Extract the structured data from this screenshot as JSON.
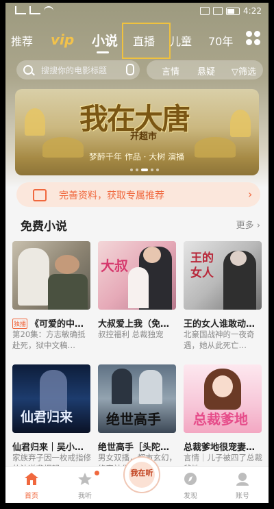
{
  "status": {
    "time": "4:22"
  },
  "tabs": [
    {
      "label": "推荐"
    },
    {
      "label": "vip"
    },
    {
      "label": "小说"
    },
    {
      "label": "直播"
    },
    {
      "label": "儿童"
    },
    {
      "label": "70年"
    }
  ],
  "search": {
    "placeholder": "搜搜你的电影标题",
    "filters": [
      "言情",
      "悬疑",
      "筛选"
    ]
  },
  "banner": {
    "title": "我在大唐",
    "subtitle": "开超市",
    "credit": "梦醉千年 作品 · 大树 演播"
  },
  "profile_tip": {
    "text": "完善资料，获取专属推荐"
  },
  "free_section": {
    "title": "免费小说",
    "more": "更多"
  },
  "books": [
    {
      "badge": "独播",
      "title": "《可爱的中…",
      "desc": "第20集：方志敏确抵赴死，狱中文稿…"
    },
    {
      "title": "大叔爱上我（免…",
      "desc": "叔控福利 总裁独宠"
    },
    {
      "title": "王的女人谁敢动…",
      "desc": "北豪国战神的一夜奇遇，她从此死亡…"
    },
    {
      "title": "仙君归来｜吴小…",
      "desc": "家族弃子因一枚戒指修仙法逆袭崛起"
    },
    {
      "title": "绝世高手［头陀…",
      "desc": "男女双播，都市玄幻，修真神作"
    },
    {
      "title": "总裁爹地很宠妻…",
      "desc": "言情｜儿子被四了总裁爹地"
    }
  ],
  "covers": [
    {
      "text": ""
    },
    {
      "text": "大叔"
    },
    {
      "text": "王的女人"
    },
    {
      "text": "仙君归来"
    },
    {
      "text": "绝世高手"
    },
    {
      "text": "总裁爹地"
    }
  ],
  "bottom_nav": [
    {
      "label": "首页"
    },
    {
      "label": "我听"
    },
    {
      "label": "发现"
    },
    {
      "label": "账号"
    }
  ],
  "center_button": {
    "label": "我在听"
  },
  "colors": {
    "accent": "#f0683e",
    "header": "#a9a48a"
  }
}
